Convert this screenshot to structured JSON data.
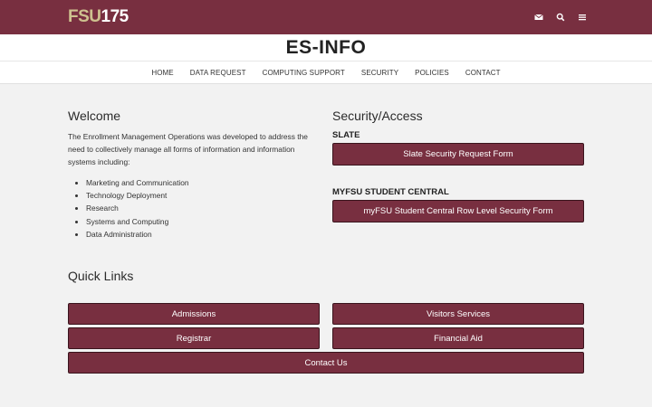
{
  "header": {
    "logo_fsu": "FSU",
    "logo_num": "175",
    "icons": [
      "mail-icon",
      "search-icon",
      "menu-icon"
    ]
  },
  "site": {
    "title": "ES-INFO"
  },
  "nav": {
    "items": [
      "HOME",
      "DATA REQUEST",
      "COMPUTING SUPPORT",
      "SECURITY",
      "POLICIES",
      "CONTACT"
    ]
  },
  "welcome": {
    "heading": "Welcome",
    "intro": "The Enrollment Management Operations was developed to address the need to collectively manage all forms of information and information systems including:",
    "list": [
      "Marketing and Communication",
      "Technology Deployment",
      "Research",
      "Systems and Computing",
      "Data Administration"
    ]
  },
  "security": {
    "heading": "Security/Access",
    "slate_label": "SLATE",
    "slate_button": "Slate Security Request Form",
    "myfsu_label": "MYFSU STUDENT CENTRAL",
    "myfsu_button": "myFSU Student Central Row Level Security Form"
  },
  "quick_links": {
    "heading": "Quick Links",
    "admissions": "Admissions",
    "visitors": "Visitors Services",
    "registrar": "Registrar",
    "financial_aid": "Financial Aid",
    "contact": "Contact Us"
  },
  "colors": {
    "garnet": "#782f40",
    "gold": "#cec18f",
    "background": "#f2f2f2"
  }
}
